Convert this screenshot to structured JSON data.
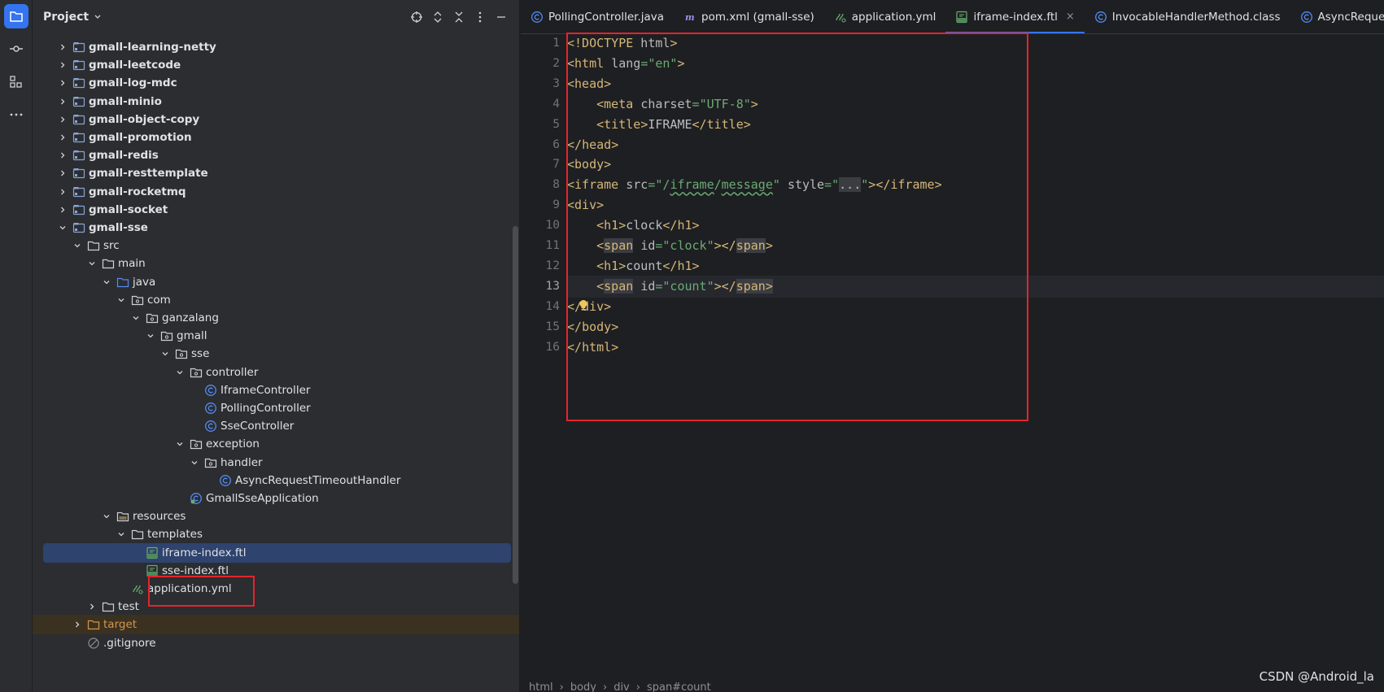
{
  "project": {
    "title": "Project",
    "tree": [
      {
        "label": "gmall-learning-netty",
        "depth": 1,
        "kind": "module",
        "expanded": false
      },
      {
        "label": "gmall-leetcode",
        "depth": 1,
        "kind": "module",
        "expanded": false
      },
      {
        "label": "gmall-log-mdc",
        "depth": 1,
        "kind": "module",
        "expanded": false
      },
      {
        "label": "gmall-minio",
        "depth": 1,
        "kind": "module",
        "expanded": false
      },
      {
        "label": "gmall-object-copy",
        "depth": 1,
        "kind": "module",
        "expanded": false
      },
      {
        "label": "gmall-promotion",
        "depth": 1,
        "kind": "module",
        "expanded": false
      },
      {
        "label": "gmall-redis",
        "depth": 1,
        "kind": "module",
        "expanded": false
      },
      {
        "label": "gmall-resttemplate",
        "depth": 1,
        "kind": "module",
        "expanded": false
      },
      {
        "label": "gmall-rocketmq",
        "depth": 1,
        "kind": "module",
        "expanded": false
      },
      {
        "label": "gmall-socket",
        "depth": 1,
        "kind": "module",
        "expanded": false
      },
      {
        "label": "gmall-sse",
        "depth": 1,
        "kind": "module",
        "expanded": true
      },
      {
        "label": "src",
        "depth": 2,
        "kind": "folder",
        "expanded": true
      },
      {
        "label": "main",
        "depth": 3,
        "kind": "folder",
        "expanded": true
      },
      {
        "label": "java",
        "depth": 4,
        "kind": "source-folder",
        "expanded": true
      },
      {
        "label": "com",
        "depth": 5,
        "kind": "package",
        "expanded": true
      },
      {
        "label": "ganzalang",
        "depth": 6,
        "kind": "package",
        "expanded": true
      },
      {
        "label": "gmall",
        "depth": 7,
        "kind": "package",
        "expanded": true
      },
      {
        "label": "sse",
        "depth": 8,
        "kind": "package",
        "expanded": true
      },
      {
        "label": "controller",
        "depth": 9,
        "kind": "package",
        "expanded": true
      },
      {
        "label": "IframeController",
        "depth": 10,
        "kind": "class"
      },
      {
        "label": "PollingController",
        "depth": 10,
        "kind": "class"
      },
      {
        "label": "SseController",
        "depth": 10,
        "kind": "class"
      },
      {
        "label": "exception",
        "depth": 9,
        "kind": "package",
        "expanded": true
      },
      {
        "label": "handler",
        "depth": 10,
        "kind": "package",
        "expanded": true
      },
      {
        "label": "AsyncRequestTimeoutHandler",
        "depth": 11,
        "kind": "class"
      },
      {
        "label": "GmallSseApplication",
        "depth": 9,
        "kind": "spring-class"
      },
      {
        "label": "resources",
        "depth": 4,
        "kind": "resources-folder",
        "expanded": true
      },
      {
        "label": "templates",
        "depth": 5,
        "kind": "folder",
        "expanded": true
      },
      {
        "label": "iframe-index.ftl",
        "depth": 6,
        "kind": "ftl",
        "selected": true
      },
      {
        "label": "sse-index.ftl",
        "depth": 6,
        "kind": "ftl"
      },
      {
        "label": "application.yml",
        "depth": 5,
        "kind": "yml"
      },
      {
        "label": "test",
        "depth": 3,
        "kind": "folder",
        "expanded": false
      },
      {
        "label": "target",
        "depth": 2,
        "kind": "excluded-folder",
        "expanded": false
      },
      {
        "label": ".gitignore",
        "depth": 2,
        "kind": "ignore"
      }
    ]
  },
  "tabs": [
    {
      "label": "PollingController.java",
      "icon": "class-icon",
      "active": false
    },
    {
      "label": "pom.xml (gmall-sse)",
      "icon": "maven-icon",
      "active": false
    },
    {
      "label": "application.yml",
      "icon": "yml-icon",
      "active": false
    },
    {
      "label": "iframe-index.ftl",
      "icon": "ftl-icon",
      "active": true,
      "close": "×"
    },
    {
      "label": "InvocableHandlerMethod.class",
      "icon": "class-icon",
      "active": false
    },
    {
      "label": "AsyncReque",
      "icon": "class-icon",
      "active": false
    }
  ],
  "editor": {
    "current_line": 13,
    "line_numbers": [
      "1",
      "2",
      "3",
      "4",
      "5",
      "6",
      "7",
      "8",
      "9",
      "10",
      "11",
      "12",
      "13",
      "14",
      "15",
      "16"
    ],
    "lines": [
      "<!DOCTYPE html>",
      "<html lang=\"en\">",
      "<head>",
      "    <meta charset=\"UTF-8\">",
      "    <title>IFRAME</title>",
      "</head>",
      "<body>",
      "<iframe src=\"/iframe/message\" style=\"...\"></iframe>",
      "<div>",
      "    <h1>clock</h1>",
      "    <span id=\"clock\"></span>",
      "    <h1>count</h1>",
      "    <span id=\"count\"></span>",
      "</div>",
      "</body>",
      "</html>"
    ]
  },
  "breadcrumb": [
    "html",
    "body",
    "div",
    "span#count"
  ],
  "watermark": "CSDN @Android_la",
  "colors": {
    "accent": "#3574f0",
    "highlight_box": "#e5242c",
    "tag": "#d5b778",
    "string": "#6aab73"
  }
}
